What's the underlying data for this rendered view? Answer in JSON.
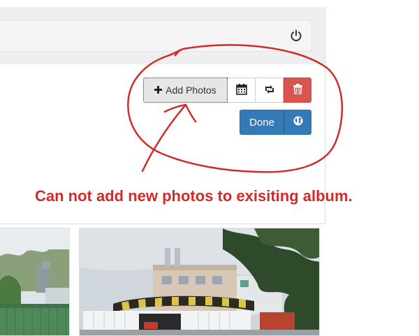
{
  "toolbar": {
    "add_photos_label": "Add Photos",
    "icons": [
      "plus-icon",
      "calendar-icon",
      "retweet-icon",
      "trash-icon",
      "globe-icon",
      "power-icon"
    ]
  },
  "publish": {
    "done_label": "Done"
  },
  "annotation": {
    "text": "Can not add new photos to exisiting album.",
    "color": "#d32a2a"
  },
  "colors": {
    "primary": "#337ab7",
    "danger": "#d9534f",
    "topbar": "#eeeff0"
  }
}
